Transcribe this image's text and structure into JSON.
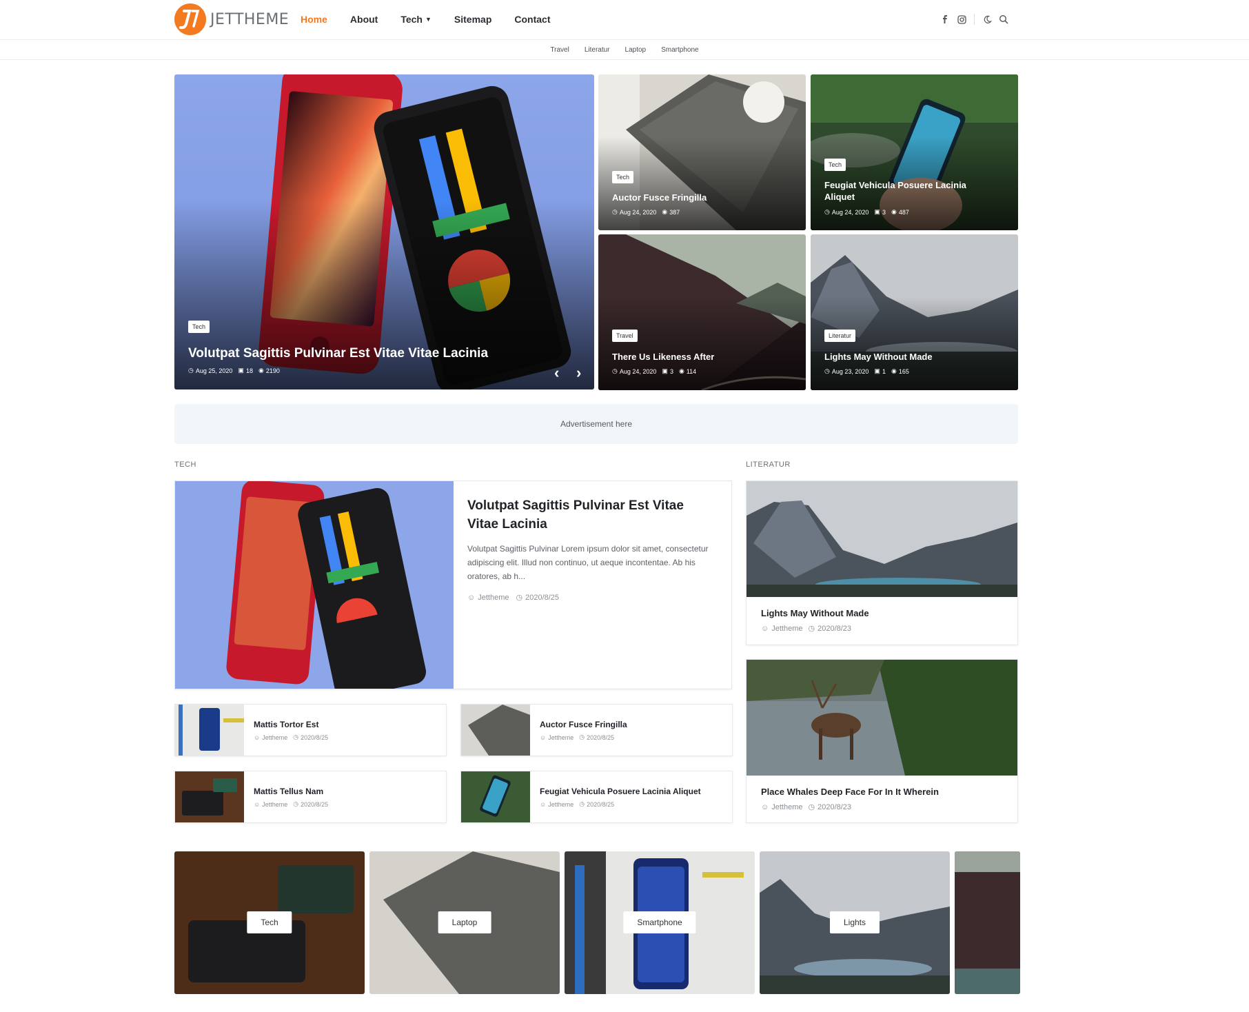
{
  "site": {
    "logo_text": "JETTHEME"
  },
  "nav": {
    "items": [
      {
        "label": "Home",
        "active": true
      },
      {
        "label": "About"
      },
      {
        "label": "Tech",
        "has_dropdown": true
      },
      {
        "label": "Sitemap"
      },
      {
        "label": "Contact"
      }
    ],
    "icons": [
      "facebook-icon",
      "instagram-icon",
      "dark-mode-icon",
      "search-icon"
    ]
  },
  "subnav": [
    "Travel",
    "Literatur",
    "Laptop",
    "Smartphone"
  ],
  "hero": {
    "main": {
      "tag": "Tech",
      "title": "Volutpat Sagittis Pulvinar Est Vitae Vitae Lacinia",
      "date": "Aug 25, 2020",
      "comments": "18",
      "views": "2190"
    },
    "cards": [
      {
        "tag": "Tech",
        "title": "Auctor Fusce Fringilla",
        "date": "Aug 24, 2020",
        "views": "387"
      },
      {
        "tag": "Tech",
        "title": "Feugiat Vehicula Posuere Lacinia Aliquet",
        "date": "Aug 24, 2020",
        "comments": "3",
        "views": "487"
      },
      {
        "tag": "Travel",
        "title": "There Us Likeness After",
        "date": "Aug 24, 2020",
        "comments": "3",
        "views": "114"
      },
      {
        "tag": "Literatur",
        "title": "Lights May Without Made",
        "date": "Aug 23, 2020",
        "comments": "1",
        "views": "165"
      }
    ]
  },
  "ad": {
    "text": "Advertisement here"
  },
  "tech_section": {
    "heading": "TECH",
    "featured": {
      "title": "Volutpat Sagittis Pulvinar Est Vitae Vitae Lacinia",
      "excerpt": "Volutpat Sagittis Pulvinar Lorem ipsum dolor sit amet, consectetur adipiscing elit. Illud non continuo, ut aeque incontentae. Ab his oratores, ab h...",
      "author": "Jettheme",
      "date": "2020/8/25"
    },
    "list": [
      {
        "title": "Mattis Tortor Est",
        "author": "Jettheme",
        "date": "2020/8/25"
      },
      {
        "title": "Auctor Fusce Fringilla",
        "author": "Jettheme",
        "date": "2020/8/25"
      },
      {
        "title": "Mattis Tellus Nam",
        "author": "Jettheme",
        "date": "2020/8/25"
      },
      {
        "title": "Feugiat Vehicula Posuere Lacinia Aliquet",
        "author": "Jettheme",
        "date": "2020/8/25"
      }
    ]
  },
  "literatur_section": {
    "heading": "LITERATUR",
    "posts": [
      {
        "title": "Lights May Without Made",
        "author": "Jettheme",
        "date": "2020/8/23"
      },
      {
        "title": "Place Whales Deep Face For In It Wherein",
        "author": "Jettheme",
        "date": "2020/8/23"
      }
    ]
  },
  "categories": [
    "Tech",
    "Laptop",
    "Smartphone",
    "Lights"
  ],
  "colors": {
    "accent": "#f47a20",
    "text": "#1f2327",
    "muted": "#8a8f94",
    "ad_bg": "#f3f6f8"
  }
}
